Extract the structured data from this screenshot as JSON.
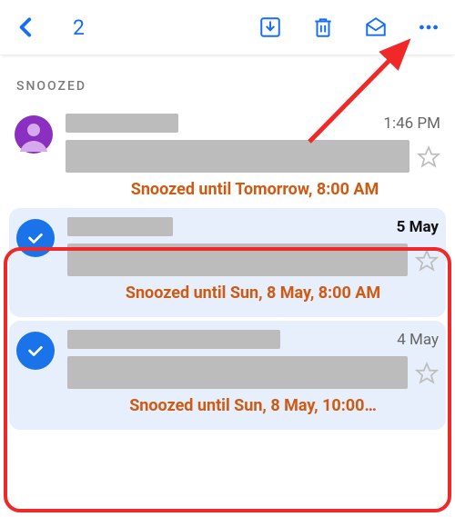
{
  "topbar": {
    "selected_count": "2"
  },
  "section": {
    "label": "SNOOZED"
  },
  "items": [
    {
      "selected": false,
      "sender_bar_width": 124,
      "timestamp": "1:46 PM",
      "timestamp_bold": false,
      "preview_bar_width": 356,
      "snooze_text": "Snoozed until Tomorrow, 8:00 AM"
    },
    {
      "selected": true,
      "sender_bar_width": 116,
      "timestamp": "5 May",
      "timestamp_bold": true,
      "preview_bar_width": 338,
      "snooze_text": "Snoozed until Sun, 8 May, 8:00 AM"
    },
    {
      "selected": true,
      "sender_bar_width": 234,
      "timestamp": "4 May",
      "timestamp_bold": false,
      "preview_bar_width": 338,
      "snooze_text": "Snoozed until Sun, 8 May, 10:00…"
    }
  ],
  "annotation": {
    "type": "red-box-and-arrow",
    "target": "overflow-button",
    "box_around": "selected-items"
  }
}
